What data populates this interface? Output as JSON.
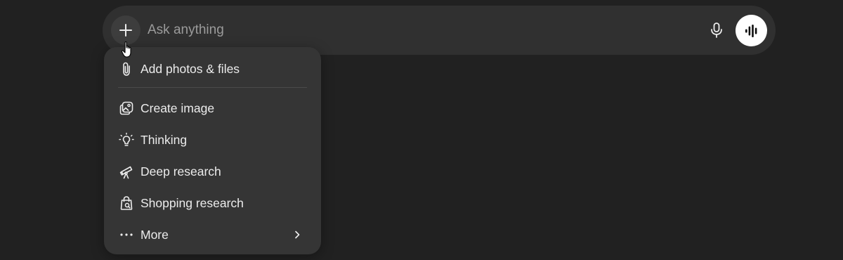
{
  "composer": {
    "placeholder": "Ask anything",
    "plus_icon": "plus-icon",
    "mic_icon": "microphone-icon",
    "voice_icon": "voice-waveform-icon"
  },
  "menu": {
    "items": [
      {
        "label": "Add photos & files",
        "icon": "paperclip-icon"
      },
      {
        "label": "Create image",
        "icon": "image-icon"
      },
      {
        "label": "Thinking",
        "icon": "lightbulb-icon"
      },
      {
        "label": "Deep research",
        "icon": "telescope-icon"
      },
      {
        "label": "Shopping research",
        "icon": "shopping-bag-icon"
      },
      {
        "label": "More",
        "icon": "ellipsis-icon",
        "has_submenu": true
      }
    ]
  },
  "colors": {
    "page_background": "#212121",
    "composer_background": "#303030",
    "menu_background": "#353535",
    "text": "#ececec",
    "placeholder": "#9b9b9b"
  }
}
